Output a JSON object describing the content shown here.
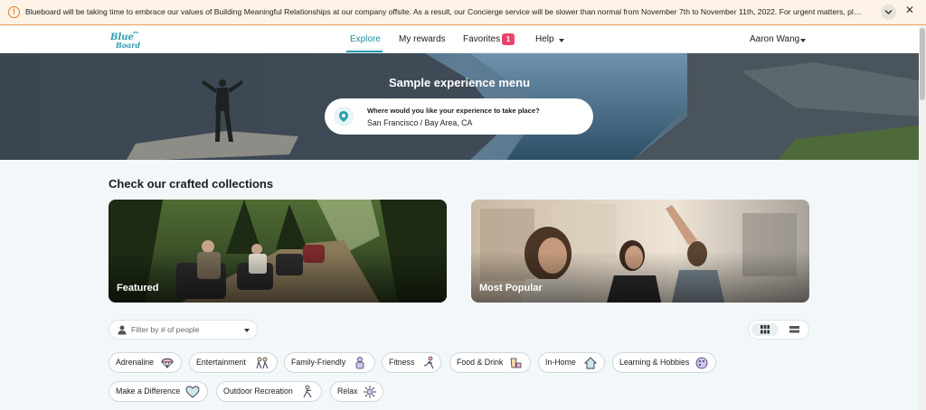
{
  "banner": {
    "text": "Blueboard will be taking time to embrace our values of Building Meaningful Relationships at our company offsite. As a result, our Concierge service will be slower than normal from November 7th to November 11th, 2022. For urgent matters, please contact the team via"
  },
  "nav": {
    "explore": "Explore",
    "rewards": "My rewards",
    "favorites": "Favorites",
    "favorites_count": "1",
    "help": "Help",
    "user": "Aaron Wang"
  },
  "hero": {
    "title": "Sample experience menu",
    "location_label": "Where would you like your experience to take place?",
    "location_value": "San Francisco / Bay Area, CA"
  },
  "collections": {
    "title": "Check our crafted collections",
    "cards": [
      "Featured",
      "Most Popular"
    ]
  },
  "filter": {
    "placeholder": "Filter by # of people"
  },
  "categories": [
    "Adrenaline",
    "Entertainment",
    "Family-Friendly",
    "Fitness",
    "Food & Drink",
    "In-Home",
    "Learning & Hobbies",
    "Make a Difference",
    "Outdoor Recreation",
    "Relax"
  ],
  "colors": {
    "accent": "#2aa0ad",
    "badge": "#e8456b",
    "banner_bg": "#fdf3e6",
    "warning": "#e07a1f"
  }
}
